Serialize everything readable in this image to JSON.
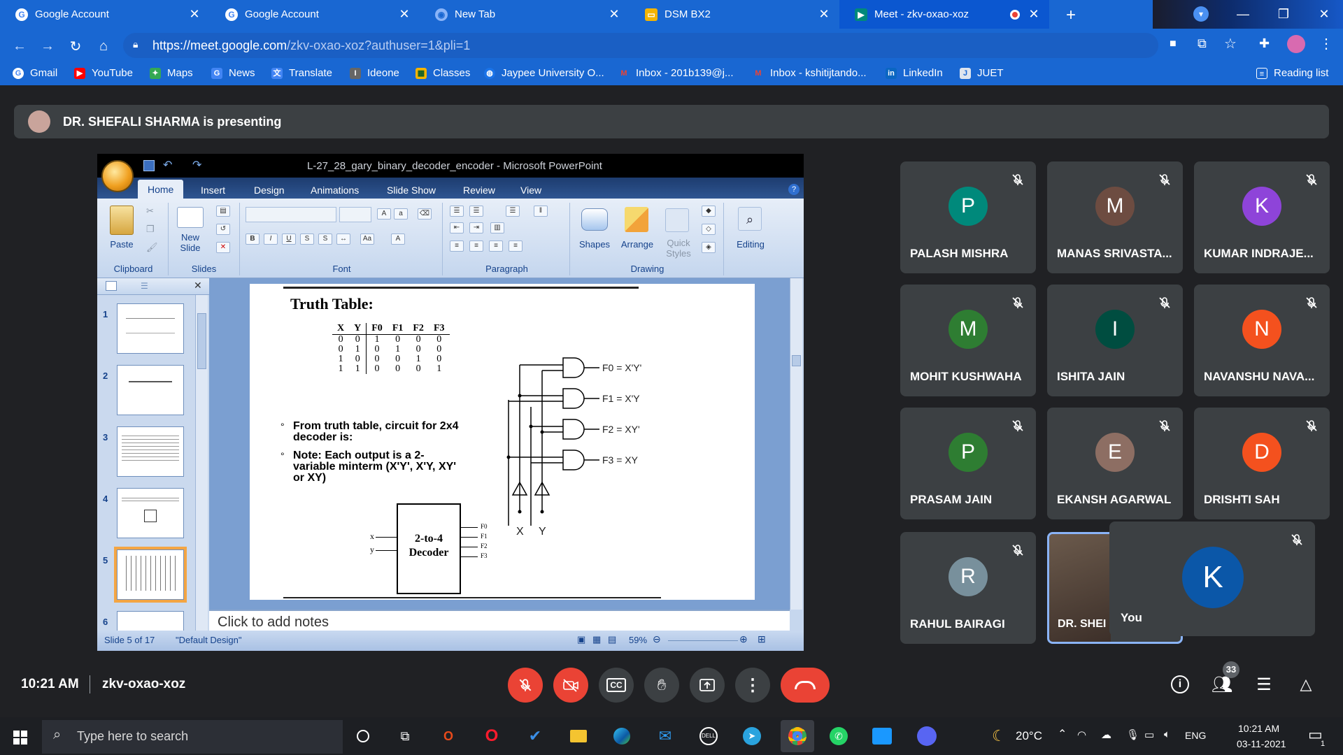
{
  "browser": {
    "tabs": [
      {
        "title": "Google Account",
        "icon": "google-icon"
      },
      {
        "title": "Google Account",
        "icon": "google-icon"
      },
      {
        "title": "New Tab",
        "icon": "chrome-icon"
      },
      {
        "title": "DSM BX2",
        "icon": "slides-icon"
      },
      {
        "title": "Meet - zkv-oxao-xoz",
        "icon": "meet-icon"
      }
    ],
    "url_host": "https://meet.google.com",
    "url_path": "/zkv-oxao-xoz?authuser=1&pli=1",
    "bookmarks": [
      "Gmail",
      "YouTube",
      "Maps",
      "News",
      "Translate",
      "Ideone",
      "Classes",
      "Jaypee University O...",
      "Inbox - 201b139@j...",
      "Inbox - kshitijtando...",
      "LinkedIn",
      "JUET"
    ],
    "reading_list": "Reading list"
  },
  "meet": {
    "presenting_text": "DR. SHEFALI SHARMA is presenting",
    "time": "10:21 AM",
    "meeting_code": "zkv-oxao-xoz",
    "participant_count": "33",
    "participants": [
      {
        "initial": "P",
        "name": "PALASH MISHRA",
        "color": "#00897b"
      },
      {
        "initial": "M",
        "name": "MANAS SRIVASTA...",
        "color": "#6d4c41"
      },
      {
        "initial": "K",
        "name": "KUMAR INDRAJE...",
        "color": "#8e44d9"
      },
      {
        "initial": "M",
        "name": "MOHIT KUSHWAHA",
        "color": "#2e7d32"
      },
      {
        "initial": "I",
        "name": "ISHITA JAIN",
        "color": "#004d40"
      },
      {
        "initial": "N",
        "name": "NAVANSHU NAVA...",
        "color": "#f4511e"
      },
      {
        "initial": "P",
        "name": "PRASAM JAIN",
        "color": "#2e7d32"
      },
      {
        "initial": "E",
        "name": "EKANSH AGARWAL",
        "color": "#8d6e63"
      },
      {
        "initial": "D",
        "name": "DRISHTI SAH",
        "color": "#f4511e"
      },
      {
        "initial": "R",
        "name": "RAHUL BAIRAGI",
        "color": "#78909c"
      }
    ],
    "presenter_tile_name": "DR. SHEI",
    "you_tile": {
      "initial": "K",
      "name": "You",
      "color": "#0b57a8"
    }
  },
  "ppt": {
    "window_title": "L-27_28_gary_binary_decoder_encoder - Microsoft PowerPoint",
    "ribbon_tabs": [
      "Home",
      "Insert",
      "Design",
      "Animations",
      "Slide Show",
      "Review",
      "View"
    ],
    "groups": {
      "clipboard": "Clipboard",
      "slides": "Slides",
      "font": "Font",
      "paragraph": "Paragraph",
      "drawing": "Drawing"
    },
    "buttons": {
      "paste": "Paste",
      "new_slide": "New Slide",
      "shapes": "Shapes",
      "arrange": "Arrange",
      "quick_styles": "Quick Styles",
      "editing": "Editing"
    },
    "slide_numbers": [
      "1",
      "2",
      "3",
      "4",
      "5",
      "6"
    ],
    "notes_placeholder": "Click to add notes",
    "status_slide": "Slide 5 of 17",
    "status_theme": "\"Default Design\"",
    "zoom": "59%",
    "slide": {
      "heading": "Truth Table:",
      "table_headers": [
        "X",
        "Y",
        "F0",
        "F1",
        "F2",
        "F3"
      ],
      "table_rows": [
        [
          "0",
          "0",
          "1",
          "0",
          "0",
          "0"
        ],
        [
          "0",
          "1",
          "0",
          "1",
          "0",
          "0"
        ],
        [
          "1",
          "0",
          "0",
          "0",
          "1",
          "0"
        ],
        [
          "1",
          "1",
          "0",
          "0",
          "0",
          "1"
        ]
      ],
      "bullet1": "From truth table, circuit for 2x4 decoder is:",
      "bullet2": "Note: Each output is a 2-variable minterm (X'Y', X'Y, XY' or XY)",
      "decoder_label_1": "2-to-4",
      "decoder_label_2": "Decoder",
      "decoder_inputs": [
        "x",
        "y"
      ],
      "decoder_outputs": [
        "F0",
        "F1",
        "F2",
        "F3"
      ],
      "gate_outputs": [
        "F0 = X'Y'",
        "F1 = X'Y",
        "F2 = XY'",
        "F3 = XY"
      ],
      "input_labels": [
        "X",
        "Y"
      ]
    }
  },
  "taskbar": {
    "search_placeholder": "Type here to search",
    "weather": "20°C",
    "language": "ENG",
    "time": "10:21 AM",
    "date": "03-11-2021",
    "notification_count": "1"
  }
}
